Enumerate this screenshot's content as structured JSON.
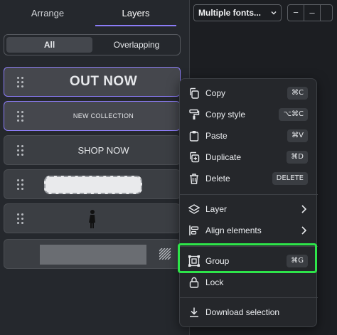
{
  "tabs": {
    "arrange": "Arrange",
    "layers": "Layers"
  },
  "filter": {
    "all": "All",
    "overlapping": "Overlapping"
  },
  "layers": {
    "out_now": "OUT NOW",
    "new_collection": "NEW COLLECTION",
    "shop_now": "SHOP NOW"
  },
  "toolbar": {
    "font": "Multiple fonts...",
    "minus": "−",
    "value": "–"
  },
  "menu": {
    "copy": {
      "label": "Copy",
      "kbd": "⌘C"
    },
    "copy_style": {
      "label": "Copy style",
      "kbd": "⌥⌘C"
    },
    "paste": {
      "label": "Paste",
      "kbd": "⌘V"
    },
    "duplicate": {
      "label": "Duplicate",
      "kbd": "⌘D"
    },
    "delete": {
      "label": "Delete",
      "kbd": "DELETE"
    },
    "layer": {
      "label": "Layer"
    },
    "align": {
      "label": "Align elements"
    },
    "group": {
      "label": "Group",
      "kbd": "⌘G"
    },
    "lock": {
      "label": "Lock"
    },
    "download": {
      "label": "Download selection"
    }
  },
  "colors": {
    "accent": "#8b7cf6",
    "highlight": "#2ee44a"
  }
}
